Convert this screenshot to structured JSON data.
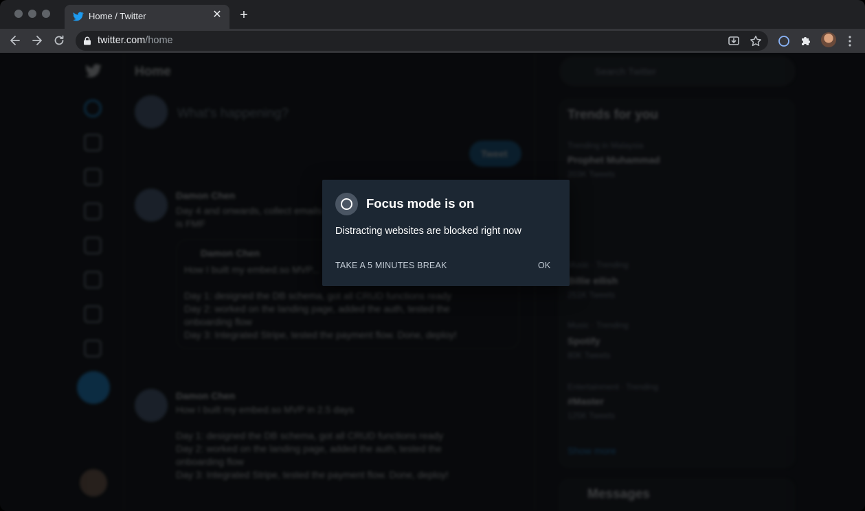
{
  "browser": {
    "tab": {
      "title": "Home / Twitter",
      "icon": "twitter-bird-icon"
    },
    "url": {
      "host": "twitter.com",
      "path": "/home"
    }
  },
  "colors": {
    "chrome_dark": "#202124",
    "chrome_toolbar": "#35363a",
    "dialog_bg": "#1c2733",
    "twitter_blue": "#1d9bf0"
  },
  "twitter": {
    "page_title": "Home",
    "compose_placeholder": "What's happening?",
    "tweet_button": "Tweet",
    "search_placeholder": "Search Twitter",
    "trends_title": "Trends for you",
    "trends": [
      {
        "context": "Trending in Malaysia",
        "name": "Prophet Muhammad",
        "count": "203K Tweets"
      },
      {
        "context": "Music · Trending",
        "name": "Billie eilish",
        "count": "251K Tweets"
      },
      {
        "context": "Music · Trending",
        "name": "Spotify",
        "count": "80K Tweets"
      },
      {
        "context": "Entertainment · Trending",
        "name": "#Master",
        "count": "125K Tweets"
      }
    ],
    "show_more": "Show more",
    "messages_title": "Messages",
    "tweets": [
      {
        "author": "Damon Chen",
        "lines": [
          "Day 4 and onwards, collect emails",
          "is FMF"
        ],
        "quote_author": "Damon Chen",
        "quote_lines": [
          "How I built my embed.so MVP...",
          "Day 1: designed the DB schema, got all CRUD functions ready",
          "Day 2: worked on the landing page, added the auth, tested the",
          "onboarding flow",
          "Day 3: Integrated Stripe, tested the payment flow. Done, deploy!"
        ]
      },
      {
        "author": "Damon Chen",
        "lines": [
          "How I built my embed.so MVP in 2.5 days",
          "Day 1: designed the DB schema, got all CRUD functions ready",
          "Day 2: worked on the landing page, added the auth, tested the",
          "onboarding flow",
          "Day 3: Integrated Stripe, tested the payment flow. Done, deploy!"
        ]
      }
    ]
  },
  "focus_dialog": {
    "title": "Focus mode is on",
    "message": "Distracting websites are blocked right now",
    "break_button": "TAKE A 5 MINUTES BREAK",
    "ok_button": "OK"
  }
}
